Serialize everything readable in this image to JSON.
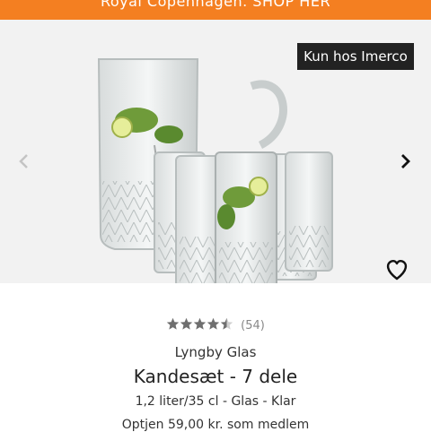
{
  "promo_banner": {
    "text": "Royal Copenhagen. SHOP HER",
    "color": "#f47f21"
  },
  "gallery": {
    "badge": "Kun hos Imerco",
    "prev_icon": "chevron-left-icon",
    "next_icon": "chevron-right-icon",
    "wishlist_icon": "heart-outline-icon",
    "background": "#f2f2f2"
  },
  "product": {
    "rating": 4.5,
    "rating_max": 5,
    "review_count": "(54)",
    "brand": "Lyngby Glas",
    "title": "Kandesæt - 7 dele",
    "specs": "1,2 liter/35 cl - Glas - Klar",
    "member_price": "Optjen 59,00 kr. som medlem"
  }
}
